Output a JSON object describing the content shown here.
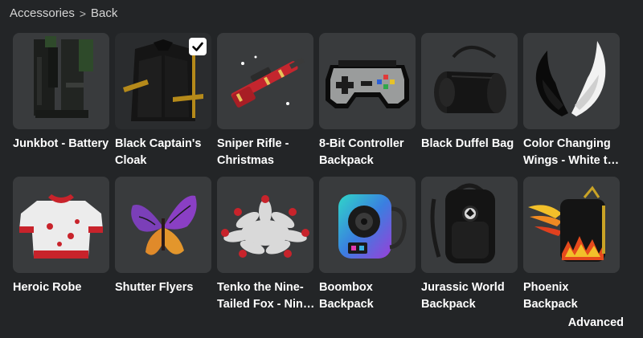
{
  "breadcrumb": {
    "parent": "Accessories",
    "separator": ">",
    "current": "Back"
  },
  "items": [
    {
      "name": "Junkbot - Battery",
      "selected": false,
      "icon": "battery-icon"
    },
    {
      "name": "Black Captain's Cloak",
      "selected": true,
      "icon": "cloak-icon"
    },
    {
      "name": "Sniper Rifle - Christmas",
      "selected": false,
      "icon": "rifle-icon"
    },
    {
      "name": "8-Bit Controller Backpack",
      "selected": false,
      "icon": "controller-icon"
    },
    {
      "name": "Black Duffel Bag",
      "selected": false,
      "icon": "duffel-bag-icon"
    },
    {
      "name": "Color Changing Wings - White to Black",
      "selected": false,
      "icon": "wings-icon"
    },
    {
      "name": "Heroic Robe",
      "selected": false,
      "icon": "robe-icon"
    },
    {
      "name": "Shutter Flyers",
      "selected": false,
      "icon": "butterfly-wings-icon"
    },
    {
      "name": "Tenko the Nine-Tailed Fox - Nine Tails",
      "selected": false,
      "icon": "fox-tails-icon"
    },
    {
      "name": "Boombox Backpack",
      "selected": false,
      "icon": "boombox-icon"
    },
    {
      "name": "Jurassic World Backpack",
      "selected": false,
      "icon": "backpack-icon"
    },
    {
      "name": "Phoenix Backpack",
      "selected": false,
      "icon": "phoenix-backpack-icon"
    }
  ],
  "footer": {
    "advanced_label": "Advanced"
  },
  "colors": {
    "background": "#232527",
    "card": "#393b3d",
    "text": "#ffffff"
  }
}
